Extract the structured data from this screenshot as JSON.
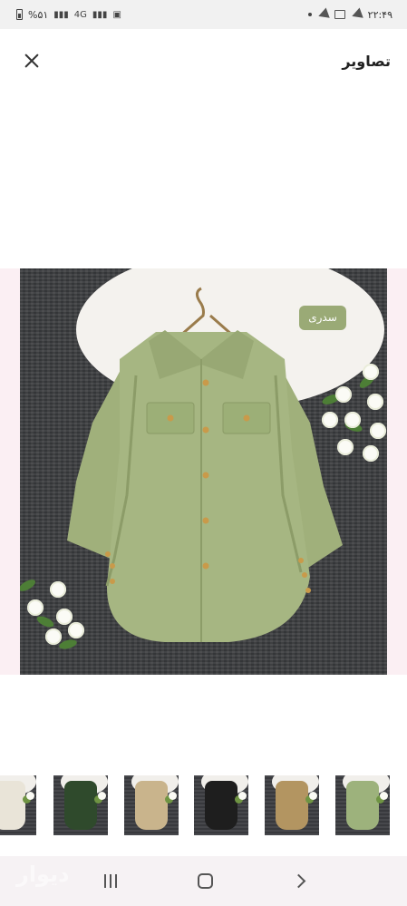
{
  "status_bar": {
    "time": "۲۲:۴۹",
    "battery": "%۵۱",
    "network": "4G"
  },
  "app_bar": {
    "title": "تصاویر",
    "close_icon": "close-icon"
  },
  "viewer": {
    "color_label": "سدری",
    "colors": {
      "shirt": "#a0b07b",
      "tag": "#9aaa76",
      "background": "#3c3d40"
    }
  },
  "thumbnails": [
    {
      "name": "cream",
      "color": "#e9e4d8"
    },
    {
      "name": "dark-green",
      "color": "#2f4a2c"
    },
    {
      "name": "beige",
      "color": "#c9b48c"
    },
    {
      "name": "black",
      "color": "#1e1e1e"
    },
    {
      "name": "camel",
      "color": "#b39561"
    },
    {
      "name": "sage",
      "color": "#9db27c"
    }
  ],
  "nav_bar": {
    "icons": [
      "recent-apps-icon",
      "home-icon",
      "back-icon"
    ]
  },
  "watermark": "دیوار"
}
